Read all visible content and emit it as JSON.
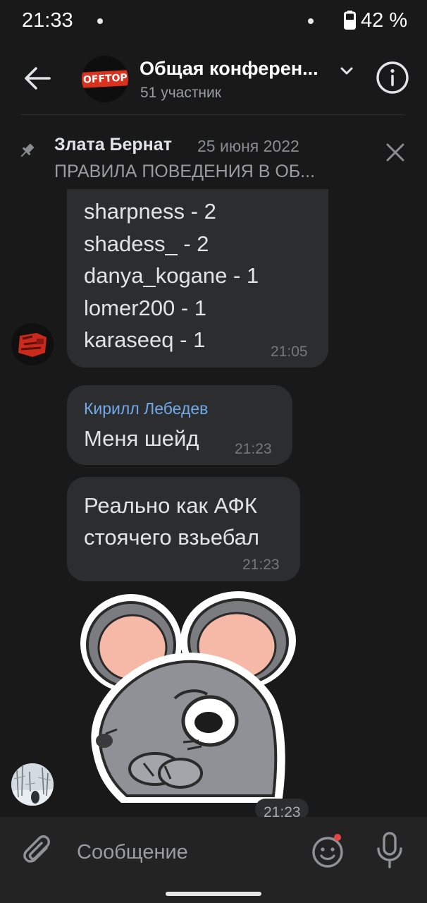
{
  "status_bar": {
    "time": "21:33",
    "battery": "42 %"
  },
  "header": {
    "title": "Общая конферен...",
    "subtitle": "51 участник",
    "avatar_logo_text": "OFFTOP"
  },
  "pinned": {
    "author": "Злата Бернат",
    "date": "25 июня 2022",
    "text": "ПРАВИЛА ПОВЕДЕНИЯ В ОБ..."
  },
  "messages": [
    {
      "lines": [
        "sharpness - 2",
        "shadess_ - 2",
        "danya_kogane - 1",
        "lomer200 - 1",
        "karaseeq - 1"
      ],
      "time": "21:05"
    },
    {
      "sender": "Кирилл Лебедев",
      "lines": [
        "Меня шейд"
      ],
      "time": "21:23"
    },
    {
      "lines": [
        "Реально как АФК",
        "стоячего взьебал"
      ],
      "time": "21:23"
    },
    {
      "sticker": "mouse-sticker",
      "time": "21:23"
    }
  ],
  "composer": {
    "placeholder": "Сообщение"
  },
  "colors": {
    "background": "#19191a",
    "bubble": "#2c2d2f",
    "sender_name": "#71aaeb",
    "notification_dot": "#e64646"
  },
  "icons": [
    "back-icon",
    "chevron-down-icon",
    "info-icon",
    "pin-icon",
    "close-icon",
    "paperclip-icon",
    "emoji-icon",
    "microphone-icon"
  ]
}
